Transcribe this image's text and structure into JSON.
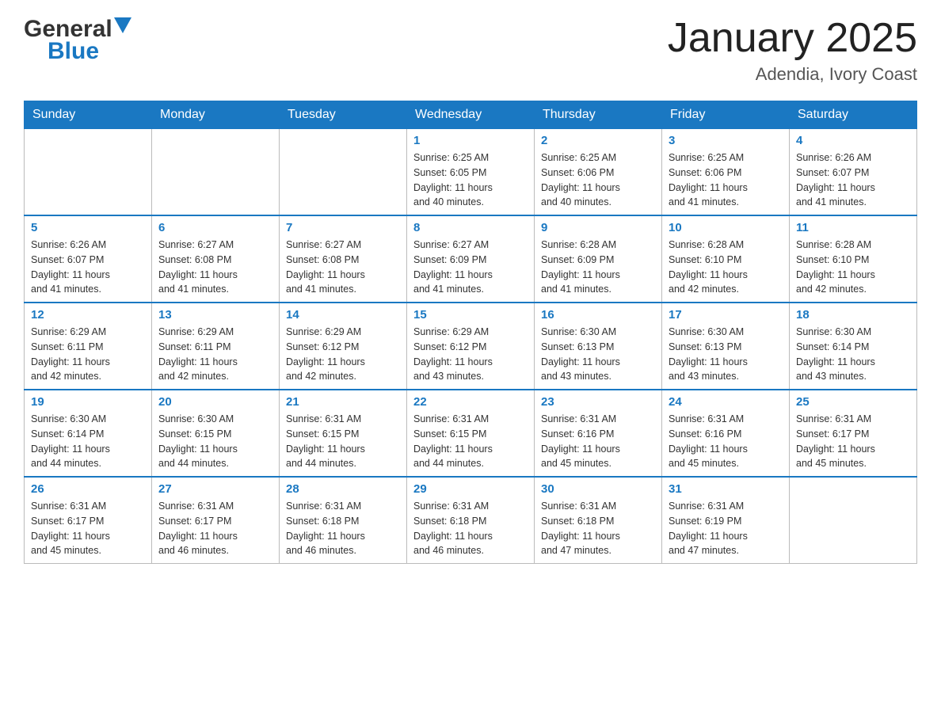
{
  "header": {
    "logo_general": "General",
    "logo_blue": "Blue",
    "month_title": "January 2025",
    "location": "Adendia, Ivory Coast"
  },
  "days_of_week": [
    "Sunday",
    "Monday",
    "Tuesday",
    "Wednesday",
    "Thursday",
    "Friday",
    "Saturday"
  ],
  "weeks": [
    [
      {
        "day": "",
        "info": ""
      },
      {
        "day": "",
        "info": ""
      },
      {
        "day": "",
        "info": ""
      },
      {
        "day": "1",
        "info": "Sunrise: 6:25 AM\nSunset: 6:05 PM\nDaylight: 11 hours\nand 40 minutes."
      },
      {
        "day": "2",
        "info": "Sunrise: 6:25 AM\nSunset: 6:06 PM\nDaylight: 11 hours\nand 40 minutes."
      },
      {
        "day": "3",
        "info": "Sunrise: 6:25 AM\nSunset: 6:06 PM\nDaylight: 11 hours\nand 41 minutes."
      },
      {
        "day": "4",
        "info": "Sunrise: 6:26 AM\nSunset: 6:07 PM\nDaylight: 11 hours\nand 41 minutes."
      }
    ],
    [
      {
        "day": "5",
        "info": "Sunrise: 6:26 AM\nSunset: 6:07 PM\nDaylight: 11 hours\nand 41 minutes."
      },
      {
        "day": "6",
        "info": "Sunrise: 6:27 AM\nSunset: 6:08 PM\nDaylight: 11 hours\nand 41 minutes."
      },
      {
        "day": "7",
        "info": "Sunrise: 6:27 AM\nSunset: 6:08 PM\nDaylight: 11 hours\nand 41 minutes."
      },
      {
        "day": "8",
        "info": "Sunrise: 6:27 AM\nSunset: 6:09 PM\nDaylight: 11 hours\nand 41 minutes."
      },
      {
        "day": "9",
        "info": "Sunrise: 6:28 AM\nSunset: 6:09 PM\nDaylight: 11 hours\nand 41 minutes."
      },
      {
        "day": "10",
        "info": "Sunrise: 6:28 AM\nSunset: 6:10 PM\nDaylight: 11 hours\nand 42 minutes."
      },
      {
        "day": "11",
        "info": "Sunrise: 6:28 AM\nSunset: 6:10 PM\nDaylight: 11 hours\nand 42 minutes."
      }
    ],
    [
      {
        "day": "12",
        "info": "Sunrise: 6:29 AM\nSunset: 6:11 PM\nDaylight: 11 hours\nand 42 minutes."
      },
      {
        "day": "13",
        "info": "Sunrise: 6:29 AM\nSunset: 6:11 PM\nDaylight: 11 hours\nand 42 minutes."
      },
      {
        "day": "14",
        "info": "Sunrise: 6:29 AM\nSunset: 6:12 PM\nDaylight: 11 hours\nand 42 minutes."
      },
      {
        "day": "15",
        "info": "Sunrise: 6:29 AM\nSunset: 6:12 PM\nDaylight: 11 hours\nand 43 minutes."
      },
      {
        "day": "16",
        "info": "Sunrise: 6:30 AM\nSunset: 6:13 PM\nDaylight: 11 hours\nand 43 minutes."
      },
      {
        "day": "17",
        "info": "Sunrise: 6:30 AM\nSunset: 6:13 PM\nDaylight: 11 hours\nand 43 minutes."
      },
      {
        "day": "18",
        "info": "Sunrise: 6:30 AM\nSunset: 6:14 PM\nDaylight: 11 hours\nand 43 minutes."
      }
    ],
    [
      {
        "day": "19",
        "info": "Sunrise: 6:30 AM\nSunset: 6:14 PM\nDaylight: 11 hours\nand 44 minutes."
      },
      {
        "day": "20",
        "info": "Sunrise: 6:30 AM\nSunset: 6:15 PM\nDaylight: 11 hours\nand 44 minutes."
      },
      {
        "day": "21",
        "info": "Sunrise: 6:31 AM\nSunset: 6:15 PM\nDaylight: 11 hours\nand 44 minutes."
      },
      {
        "day": "22",
        "info": "Sunrise: 6:31 AM\nSunset: 6:15 PM\nDaylight: 11 hours\nand 44 minutes."
      },
      {
        "day": "23",
        "info": "Sunrise: 6:31 AM\nSunset: 6:16 PM\nDaylight: 11 hours\nand 45 minutes."
      },
      {
        "day": "24",
        "info": "Sunrise: 6:31 AM\nSunset: 6:16 PM\nDaylight: 11 hours\nand 45 minutes."
      },
      {
        "day": "25",
        "info": "Sunrise: 6:31 AM\nSunset: 6:17 PM\nDaylight: 11 hours\nand 45 minutes."
      }
    ],
    [
      {
        "day": "26",
        "info": "Sunrise: 6:31 AM\nSunset: 6:17 PM\nDaylight: 11 hours\nand 45 minutes."
      },
      {
        "day": "27",
        "info": "Sunrise: 6:31 AM\nSunset: 6:17 PM\nDaylight: 11 hours\nand 46 minutes."
      },
      {
        "day": "28",
        "info": "Sunrise: 6:31 AM\nSunset: 6:18 PM\nDaylight: 11 hours\nand 46 minutes."
      },
      {
        "day": "29",
        "info": "Sunrise: 6:31 AM\nSunset: 6:18 PM\nDaylight: 11 hours\nand 46 minutes."
      },
      {
        "day": "30",
        "info": "Sunrise: 6:31 AM\nSunset: 6:18 PM\nDaylight: 11 hours\nand 47 minutes."
      },
      {
        "day": "31",
        "info": "Sunrise: 6:31 AM\nSunset: 6:19 PM\nDaylight: 11 hours\nand 47 minutes."
      },
      {
        "day": "",
        "info": ""
      }
    ]
  ]
}
